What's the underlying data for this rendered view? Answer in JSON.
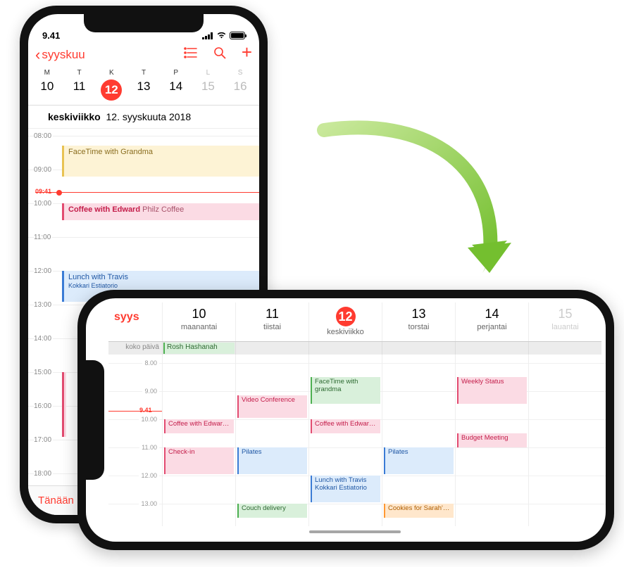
{
  "status": {
    "time": "9.41"
  },
  "portrait": {
    "back": "syyskuu",
    "weekdays": [
      "M",
      "T",
      "K",
      "T",
      "P",
      "L",
      "S"
    ],
    "daynums": [
      "10",
      "11",
      "12",
      "13",
      "14",
      "15",
      "16"
    ],
    "today_index": 2,
    "date_line_weekday": "keskiviikko",
    "date_line_rest": "12. syyskuuta 2018",
    "now": "09:41",
    "hours": [
      "08:00",
      "09:00",
      "10:00",
      "11:00",
      "12:00",
      "13:00",
      "14:00",
      "15:00",
      "16:00",
      "17:00",
      "18:00"
    ],
    "events": {
      "facetime": "FaceTime with Grandma",
      "coffee": "Coffee with Edward",
      "coffee_loc": "Philz Coffee",
      "lunch": "Lunch with Travis",
      "lunch_loc": "Kokkari Estiatorio"
    },
    "today_button": "Tänään"
  },
  "landscape": {
    "month": "syys",
    "days": [
      {
        "num": "10",
        "name": "maanantai"
      },
      {
        "num": "11",
        "name": "tiistai"
      },
      {
        "num": "12",
        "name": "keskiviikko"
      },
      {
        "num": "13",
        "name": "torstai"
      },
      {
        "num": "14",
        "name": "perjantai"
      },
      {
        "num": "15",
        "name": "lauantai"
      }
    ],
    "today_index": 2,
    "allday_label": "koko päivä",
    "allday_event": "Rosh Hashanah",
    "hours": [
      "8.00",
      "9.00",
      "10.00",
      "11.00",
      "12.00",
      "13.00"
    ],
    "now": "9.41",
    "events": {
      "coffee_mon": "Coffee with Edwar…",
      "checkin": "Check-in",
      "video": "Video Conference",
      "pilates": "Pilates",
      "couch": "Couch delivery",
      "facetime": "FaceTime with grandma",
      "coffee_wed": "Coffee with Edwar…",
      "lunch": "Lunch with Travis",
      "lunch_loc": "Kokkari Estiatorio",
      "pilates2": "Pilates",
      "cookies": "Cookies for Sarah'…",
      "weekly": "Weekly Status",
      "budget": "Budget Meeting"
    }
  }
}
